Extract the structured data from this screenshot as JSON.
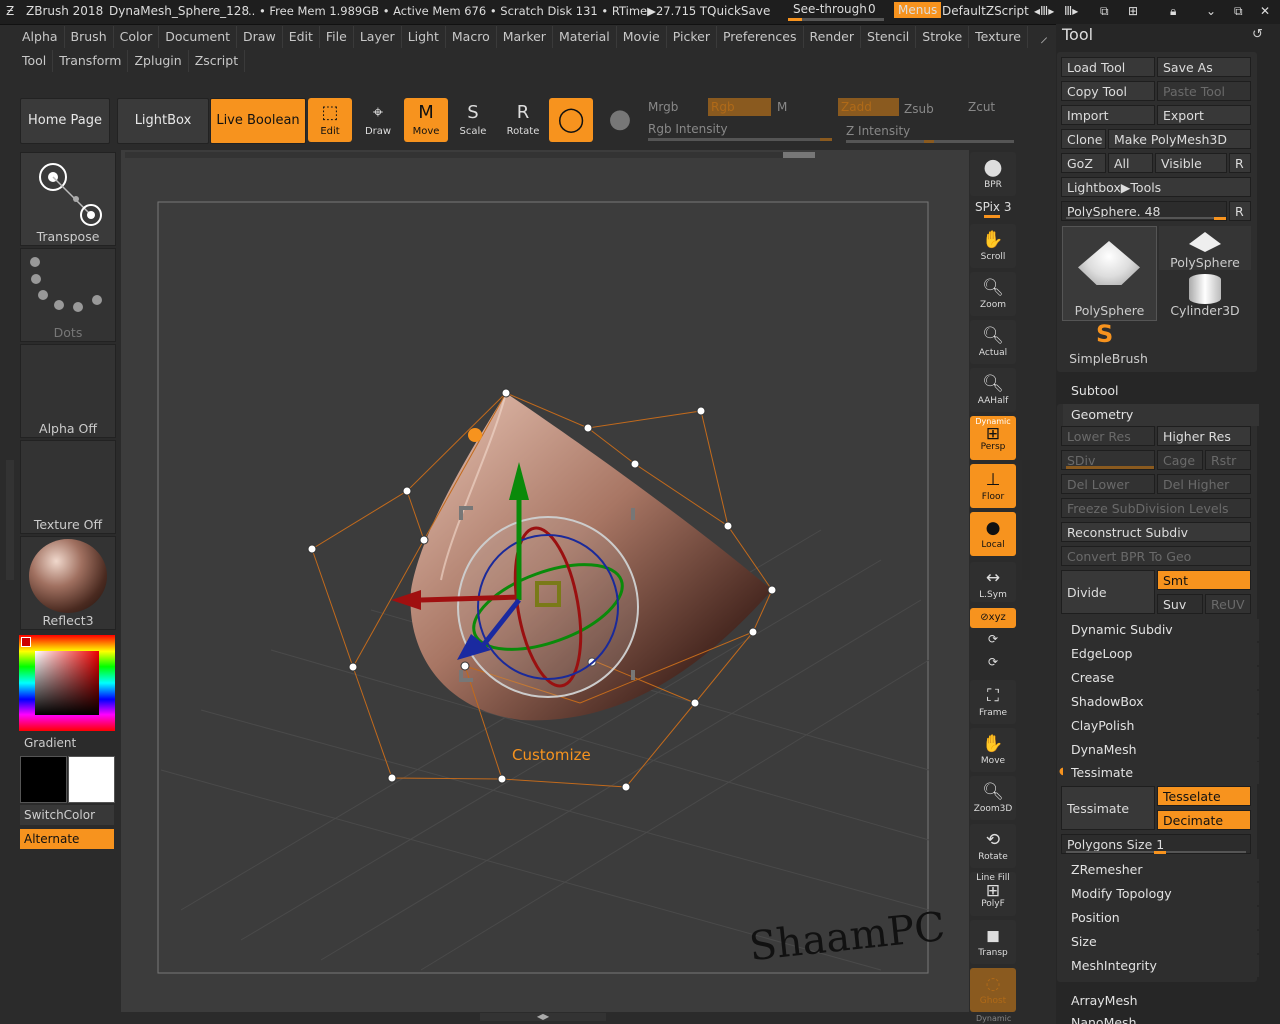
{
  "titlebar": {
    "app": "ZBrush 2018",
    "doc": "DynaMesh_Sphere_128",
    "stats": ".. • Free Mem 1.989GB • Active Mem 676 • Scratch Disk 131 •  RTime▶27.715 T",
    "quicksave": "QuickSave",
    "see_through": "See-through",
    "see_through_val": "0",
    "menus": "Menus",
    "script": "DefaultZScript"
  },
  "menus": {
    "row1": [
      "Alpha",
      "Brush",
      "Color",
      "Document",
      "Draw",
      "Edit",
      "File",
      "Layer",
      "Light",
      "Macro",
      "Marker",
      "Material",
      "Movie",
      "Picker",
      "Preferences",
      "Render",
      "Stencil",
      "Stroke",
      "Texture"
    ],
    "row2": [
      "Tool",
      "Transform",
      "Zplugin",
      "Zscript"
    ]
  },
  "shelf": {
    "home": "Home Page",
    "lightbox": "LightBox",
    "live_boolean": "Live Boolean",
    "edit": "Edit",
    "draw": "Draw",
    "move": "Move",
    "scale": "Scale",
    "rotate": "Rotate",
    "mrgb": "Mrgb",
    "rgb": "Rgb",
    "m": "M",
    "zadd": "Zadd",
    "zsub": "Zsub",
    "zcut": "Zcut",
    "rgb_intensity": "Rgb Intensity",
    "z_intensity": "Z Intensity"
  },
  "left": {
    "transpose": "Transpose",
    "dots": "Dots",
    "alpha": "Alpha Off",
    "texture": "Texture Off",
    "material": "Reflect3",
    "gradient": "Gradient",
    "switchcolor": "SwitchColor",
    "alternate": "Alternate"
  },
  "viewport": {
    "customize": "Customize",
    "watermark": "ShaamPC"
  },
  "rightshelf": {
    "bpr": "BPR",
    "spix": "SPix 3",
    "scroll": "Scroll",
    "zoom": "Zoom",
    "actual": "Actual",
    "aahalf": "AAHalf",
    "dynamic": "Dynamic",
    "persp": "Persp",
    "floor": "Floor",
    "local": "Local",
    "lsym": "L.Sym",
    "xyz": "⊘xyz",
    "frame": "Frame",
    "move": "Move",
    "zoom3d": "Zoom3D",
    "rotate": "Rotate",
    "linefill": "Line Fill",
    "polyf": "PolyF",
    "transp": "Transp",
    "ghost": "Ghost",
    "dynamic2": "Dynamic"
  },
  "tool": {
    "title": "Tool",
    "load": "Load Tool",
    "saveas": "Save As",
    "copy": "Copy Tool",
    "paste": "Paste Tool",
    "import": "Import",
    "export": "Export",
    "clone": "Clone",
    "make": "Make PolyMesh3D",
    "goz": "GoZ",
    "all": "All",
    "visible": "Visible",
    "r": "R",
    "lightbox_tools": "Lightbox▶Tools",
    "polysphere_slider": "PolySphere. 48",
    "thumbs": [
      "PolySphere",
      "PolySphere",
      "Cylinder3D",
      "SimpleBrush"
    ],
    "subtool": "Subtool",
    "geometry": "Geometry",
    "lower": "Lower Res",
    "higher": "Higher Res",
    "sdiv": "SDiv",
    "cage": "Cage",
    "rstr": "Rstr",
    "del_lower": "Del Lower",
    "del_higher": "Del Higher",
    "freeze": "Freeze SubDivision Levels",
    "reconstruct": "Reconstruct Subdiv",
    "convert": "Convert BPR To Geo",
    "divide": "Divide",
    "smt": "Smt",
    "suv": "Suv",
    "reuv": "ReUV",
    "sections": [
      "Dynamic Subdiv",
      "EdgeLoop",
      "Crease",
      "ShadowBox",
      "ClayPolish",
      "DynaMesh"
    ],
    "tessimate_hdr": "Tessimate",
    "tessimate": "Tessimate",
    "tesselate": "Tesselate",
    "decimate": "Decimate",
    "polysize": "Polygons Size 1",
    "sections2": [
      "ZRemesher",
      "Modify Topology",
      "Position",
      "Size",
      "MeshIntegrity"
    ],
    "arraymesh": "ArrayMesh",
    "nanomesh": "NanoMesh"
  },
  "colors": {
    "accent": "#f7931e",
    "bg": "#2b2b2b",
    "viewport": "#3c3c3c"
  }
}
